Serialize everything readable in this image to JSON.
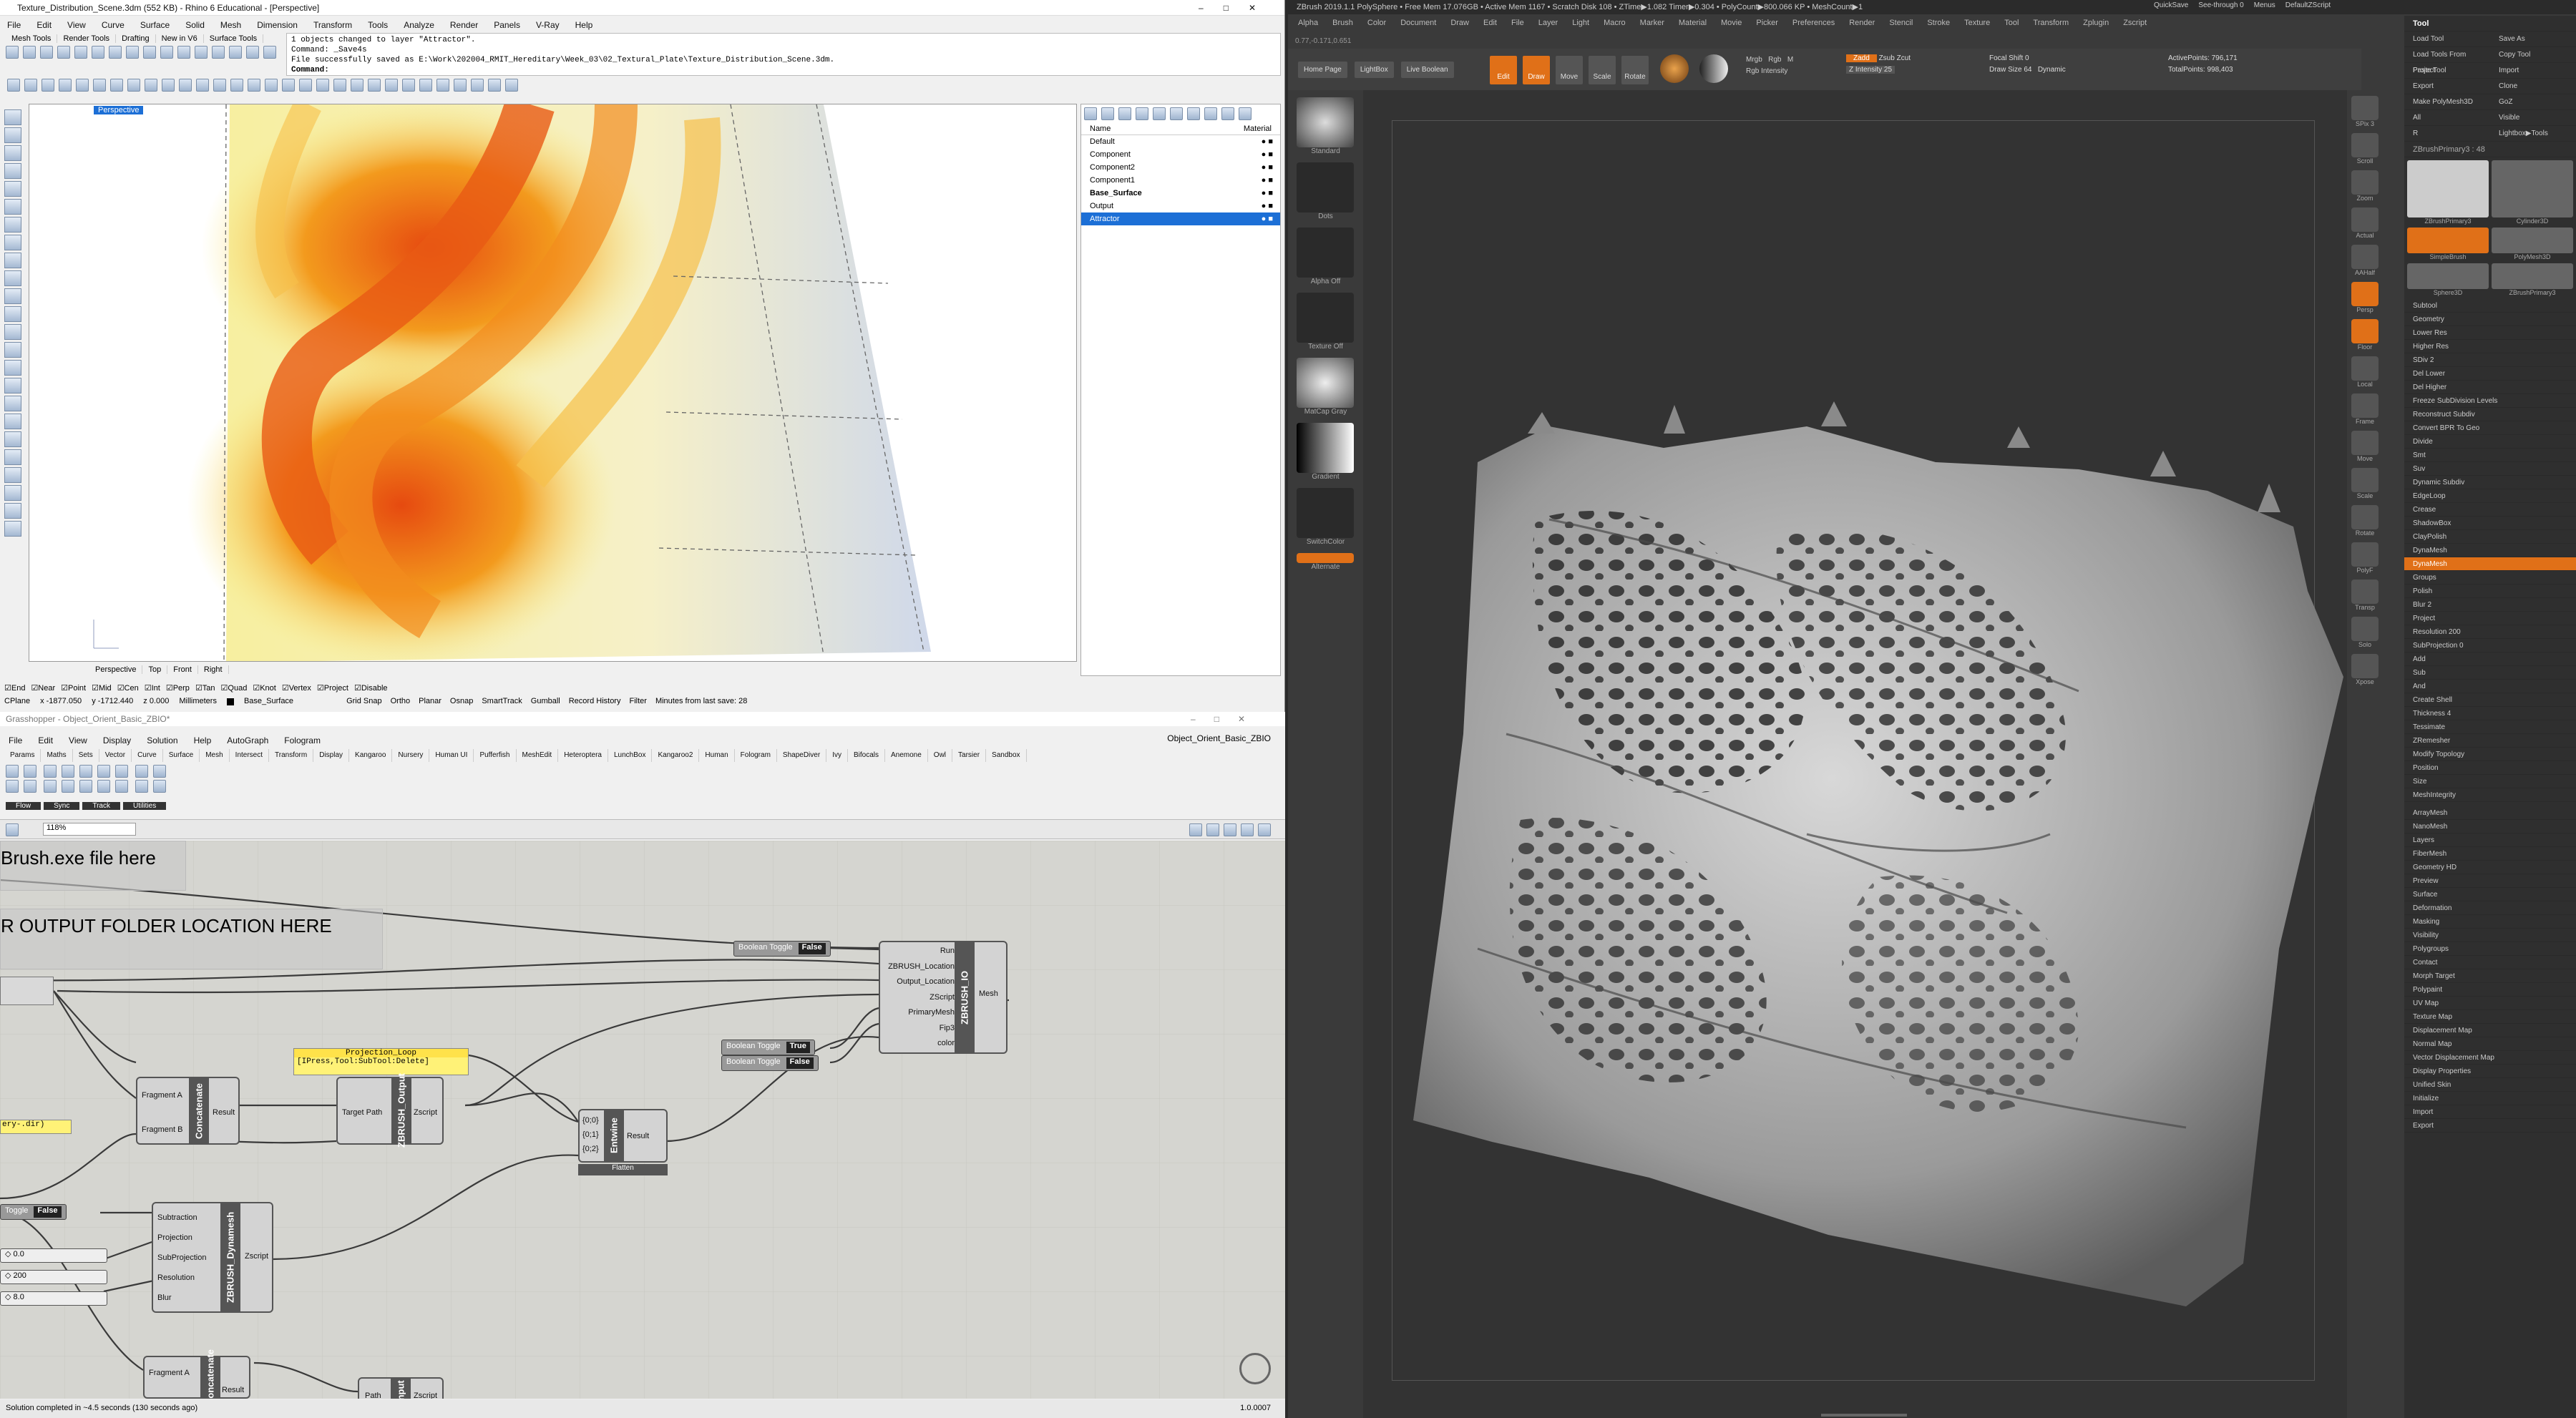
{
  "rhino": {
    "title": "Texture_Distribution_Scene.3dm (552 KB) - Rhino 6 Educational - [Perspective]",
    "menu": [
      "File",
      "Edit",
      "View",
      "Curve",
      "Surface",
      "Solid",
      "Mesh",
      "Dimension",
      "Transform",
      "Tools",
      "Analyze",
      "Render",
      "Panels",
      "V-Ray",
      "Help"
    ],
    "cmd_lines": [
      "1 objects changed to layer \"Attractor\".",
      "Command: _Save4s",
      "File successfully saved as E:\\Work\\202004_RMIT_Hereditary\\Week_03\\02_Textural_Plate\\Texture_Distribution_Scene.3dm."
    ],
    "cmd_prompt": "Command:",
    "toolbar_tabs": [
      "Mesh Tools",
      "Render Tools",
      "Drafting",
      "New in V6",
      "Surface Tools"
    ],
    "viewport_label": "Perspective",
    "view_tabs": [
      "Perspective",
      "Top",
      "Front",
      "Right"
    ],
    "layers_header": [
      "Name",
      "Material"
    ],
    "layers": [
      "Default",
      "Component",
      "Component2",
      "Component1",
      "Base_Surface",
      "Output",
      "Attractor"
    ],
    "osnaps": [
      "End",
      "Near",
      "Point",
      "Mid",
      "Cen",
      "Int",
      "Perp",
      "Tan",
      "Quad",
      "Knot",
      "Vertex",
      "Project",
      "Disable"
    ],
    "status": {
      "cplane": "CPlane",
      "x": "x -1877.050",
      "y": "y -1712.440",
      "z": "z 0.000",
      "units": "Millimeters",
      "layer": "Base_Surface",
      "items": [
        "Grid Snap",
        "Ortho",
        "Planar",
        "Osnap",
        "SmartTrack",
        "Gumball",
        "Record History",
        "Filter",
        "Minutes from last save: 28"
      ]
    }
  },
  "gh": {
    "title": "Grasshopper - Object_Orient_Basic_ZBIO*",
    "doc": "Object_Orient_Basic_ZBIO",
    "menu": [
      "File",
      "Edit",
      "View",
      "Display",
      "Solution",
      "Help",
      "AutoGraph",
      "Fologram"
    ],
    "tabs": [
      "Params",
      "Maths",
      "Sets",
      "Vector",
      "Curve",
      "Surface",
      "Mesh",
      "Intersect",
      "Transform",
      "Display",
      "Kangaroo",
      "Nursery",
      "Human UI",
      "Pufferfish",
      "MeshEdit",
      "Heteroptera",
      "LunchBox",
      "Kangaroo2",
      "Human",
      "Fologram",
      "ShapeDiver",
      "Ivy",
      "Bifocals",
      "Anemone",
      "Owl",
      "Tarsier",
      "Sandbox"
    ],
    "groups": [
      "Flow",
      "Sync",
      "Track",
      "Utilities"
    ],
    "zoom": "118%",
    "canvas_text": [
      "Brush.exe file here",
      "R OUTPUT FOLDER LOCATION HERE"
    ],
    "status": "Solution completed in ~4.5 seconds (130 seconds ago)",
    "version": "1.0.0007",
    "zbrush_io": {
      "name": "ZBRUSH_IO",
      "inputs": [
        "Run",
        "ZBRUSH_Location",
        "Output_Location",
        "ZScript",
        "PrimaryMesh",
        "Fip3",
        "color"
      ],
      "output": "Mesh"
    },
    "toggles": [
      {
        "label": "Boolean Toggle",
        "value": "False"
      },
      {
        "label": "Boolean Toggle",
        "value": "True"
      },
      {
        "label": "Boolean Toggle",
        "value": "False"
      },
      {
        "label": "Toggle",
        "value": "False"
      }
    ],
    "proj_loop": {
      "title": "Projection_Loop",
      "value": "[IPress,Tool:SubTool:Delete]"
    },
    "concat1": {
      "name": "Concatenate",
      "inputs": [
        "Fragment A",
        "Fragment B"
      ],
      "output": "Result"
    },
    "zoutput": {
      "name": "ZBRUSH_Output",
      "input": "Target Path",
      "output": "Zscript"
    },
    "entwine": {
      "name": "Entwine",
      "inputs": [
        "{0;0}",
        "{0;1}",
        "{0;2}"
      ],
      "output": "Result",
      "flag": "Flatten"
    },
    "dynamesh": {
      "name": "ZBRUSH_Dynamesh",
      "inputs": [
        "Subtraction",
        "Projection",
        "SubProjection",
        "Resolution",
        "Blur"
      ],
      "output": "Zscript"
    },
    "sliders": [
      "0.0",
      "200",
      "8.0"
    ],
    "left_panel": "ery-.dir)",
    "concat2": {
      "inputs": [
        "Fragment A"
      ],
      "output": "Result"
    },
    "input2": {
      "inputs": [
        "Path"
      ],
      "output": "Zscript"
    }
  },
  "zb": {
    "title": "ZBrush 2019.1.1  PolySphere  • Free Mem 17.076GB • Active Mem 1167 • Scratch Disk 108 • ZTime▶1.082 Timer▶0.304 • PolyCount▶800.066 KP • MeshCount▶1",
    "menu": [
      "Alpha",
      "Brush",
      "Color",
      "Document",
      "Draw",
      "Edit",
      "File",
      "Layer",
      "Light",
      "Macro",
      "Marker",
      "Material",
      "Movie",
      "Picker",
      "Preferences",
      "Render",
      "Stencil",
      "Stroke",
      "Texture",
      "Tool",
      "Transform",
      "Zplugin",
      "Zscript"
    ],
    "right_menu": [
      "QuickSave",
      "See-through 0",
      "Menus",
      "DefaultZScript"
    ],
    "top_buttons": [
      "Home Page",
      "LightBox",
      "Live Boolean"
    ],
    "modes": [
      "Edit",
      "Draw",
      "Move",
      "Scale",
      "Rotate"
    ],
    "params": {
      "mrgb": "Mrgb",
      "rgb": "Rgb",
      "m": "M",
      "zadd": "Zadd",
      "zsub": "Zsub",
      "zcut": "Zcut",
      "focal": "Focal Shift 0",
      "draw_size": "Draw Size 64",
      "dynamic": "Dynamic",
      "rgb_int": "Rgb Intensity",
      "z_int": "Z Intensity 25",
      "active_points": "ActivePoints: 796,171",
      "total_points": "TotalPoints: 998,403"
    },
    "coord": "0.77,-0.171,0.651",
    "left_shelf": [
      "Standard",
      "Dots",
      "Alpha Off",
      "Texture Off",
      "MatCap Gray",
      "Gradient",
      "SwitchColor",
      "Alternate"
    ],
    "right_shelf": [
      "SPix 3",
      "Scroll",
      "Zoom",
      "Actual",
      "AAHalf",
      "Persp",
      "Floor",
      "Local",
      "Frame",
      "Move",
      "Scale",
      "Rotate",
      "PolyF",
      "Transp",
      "Solo",
      "Xpose"
    ],
    "tool_title": "Tool",
    "tool_top": [
      "Load Tool",
      "Save As",
      "Load Tools From Project",
      "Copy Tool",
      "Paste Tool",
      "Import",
      "Export",
      "Clone",
      "Make PolyMesh3D",
      "GoZ",
      "All",
      "Visible",
      "R",
      "Lightbox▶Tools"
    ],
    "tool_name": "ZBrushPrimary3 : 48",
    "tool_thumbs": [
      "ZBrushPrimary3",
      "Cylinder3D",
      "SimpleBrush",
      "PolyMesh3D",
      "Sphere3D",
      "ZBrushPrimary3"
    ],
    "subtool": [
      "Subtool",
      "Geometry",
      "Lower Res",
      "Higher Res",
      "SDiv 2",
      "Del Lower",
      "Del Higher",
      "Freeze SubDivision Levels",
      "Reconstruct Subdiv",
      "Convert BPR To Geo",
      "Divide",
      "Smt",
      "Suv",
      "Dynamic Subdiv",
      "EdgeLoop",
      "Crease",
      "ShadowBox",
      "ClayPolish",
      "DynaMesh",
      "DynaMesh",
      "Groups",
      "Polish",
      "Blur 2",
      "Project",
      "Resolution 200",
      "SubProjection 0",
      "Add",
      "Sub",
      "And",
      "Create Shell",
      "Thickness 4",
      "Tessimate",
      "ZRemesher",
      "Modify Topology",
      "Position",
      "Size",
      "MeshIntegrity"
    ],
    "tool_lower": [
      "ArrayMesh",
      "NanoMesh",
      "Layers",
      "FiberMesh",
      "Geometry HD",
      "Preview",
      "Surface",
      "Deformation",
      "Masking",
      "Visibility",
      "Polygroups",
      "Contact",
      "Morph Target",
      "Polypaint",
      "UV Map",
      "Texture Map",
      "Displacement Map",
      "Normal Map",
      "Vector Displacement Map",
      "Display Properties",
      "Unified Skin",
      "Initialize",
      "Import",
      "Export"
    ],
    "colors": {
      "accent": "#e07018",
      "bg": "#3a3a3a",
      "canvas": "#333333"
    }
  }
}
